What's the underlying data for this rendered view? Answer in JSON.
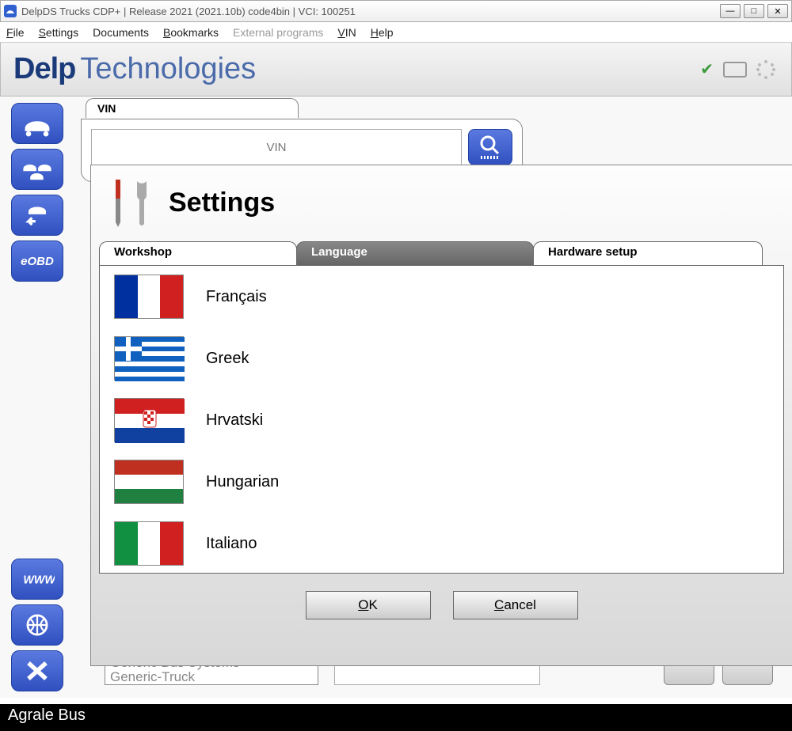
{
  "window": {
    "title": "DelpDS Trucks CDP+ | Release 2021 (2021.10b) code4bin  |  VCI: 100251"
  },
  "menu": {
    "file": "File",
    "settings": "Settings",
    "documents": "Documents",
    "bookmarks": "Bookmarks",
    "external": "External programs",
    "vin": "VIN",
    "help": "Help"
  },
  "logo": {
    "part1": "Delp",
    "part2": "Technologies"
  },
  "sidebar": {
    "eobd": "eOBD"
  },
  "vin_section": {
    "tab_label": "VIN",
    "placeholder": "VIN"
  },
  "partial": {
    "line1": "Generic Bus Systems",
    "line2": "Generic-Truck"
  },
  "dialog": {
    "title": "Settings",
    "tabs": {
      "workshop": "Workshop",
      "language": "Language",
      "hardware": "Hardware setup"
    },
    "languages": [
      {
        "label": "Français",
        "flag": "fr"
      },
      {
        "label": "Greek",
        "flag": "gr"
      },
      {
        "label": "Hrvatski",
        "flag": "hr"
      },
      {
        "label": "Hungarian",
        "flag": "hu"
      },
      {
        "label": "Italiano",
        "flag": "it"
      }
    ],
    "ok": "OK",
    "cancel": "Cancel"
  },
  "status": "Agrale Bus"
}
